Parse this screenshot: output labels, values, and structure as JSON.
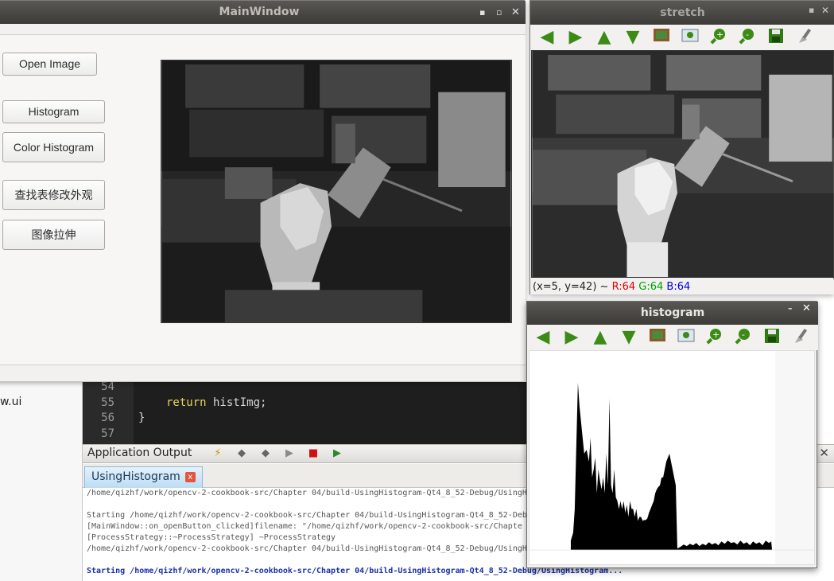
{
  "ide": {
    "left_file": "w.ui",
    "line_numbers": [
      "54",
      "55",
      "56",
      "57"
    ],
    "code_line_55_keyword": "return",
    "code_line_55_rest": " histImg;",
    "code_line_56": "}",
    "output_pane_title": "Application Output",
    "output_tab": "UsingHistogram",
    "output_tab_close": "x",
    "output_close": "✕",
    "output_lines": [
      {
        "text": "/home/qizhf/work/opencv-2-cookbook-src/Chapter 04/build-UsingHistogram-Qt4_8_52-Debug/UsingHi",
        "style": "gray"
      },
      {
        "text": "",
        "style": "gray"
      },
      {
        "text": "Starting /home/qizhf/work/opencv-2-cookbook-src/Chapter 04/build-UsingHistogram-Qt4_8_52-Deb",
        "style": "gray"
      },
      {
        "text": "[MainWindow::on_openButton_clicked]filename:  \"/home/qizhf/work/opencv-2-cookbook-src/Chapte",
        "style": "gray"
      },
      {
        "text": "[ProcessStrategy::~ProcessStrategy] ~ProcessStrategy",
        "style": "gray"
      },
      {
        "text": "/home/qizhf/work/opencv-2-cookbook-src/Chapter 04/build-UsingHistogram-Qt4_8_52-Debug/UsingHi",
        "style": "gray"
      },
      {
        "text": "",
        "style": "gray"
      },
      {
        "text": "Starting /home/qizhf/work/opencv-2-cookbook-src/Chapter 04/build-UsingHistogram-Qt4_8_52-Debug/UsingHistogram...",
        "style": "blue"
      }
    ]
  },
  "main_window": {
    "title": "MainWindow",
    "controls": [
      "▪",
      "▫",
      "✕"
    ],
    "buttons": {
      "open_image": "Open Image",
      "histogram": "Histogram",
      "color_histogram": "Color Histogram",
      "lookup_table": "查找表修改外观",
      "stretch": "图像拉伸"
    }
  },
  "stretch_window": {
    "title": "stretch",
    "close": "✕",
    "minimize": "▪",
    "status_prefix": "(x=5, y=42) ~ ",
    "status_r": "R:64",
    "status_g": "G:64",
    "status_b": "B:64"
  },
  "histogram_window": {
    "title": "histogram",
    "close": "✕",
    "minimize": "–"
  },
  "toolbar_icons": [
    "arrow-left-icon",
    "arrow-right-icon",
    "arrow-up-icon",
    "arrow-down-icon",
    "image-icon",
    "zoom-fit-icon",
    "zoom-in-icon",
    "zoom-out-icon",
    "save-icon",
    "brush-icon"
  ],
  "colors": {
    "title_bar": "#3c3b37",
    "arrow_green": "#3b8b16",
    "status_red": "#e00000",
    "status_green": "#00a000",
    "status_blue": "#0000e0",
    "output_blue": "#1b2fa8"
  }
}
